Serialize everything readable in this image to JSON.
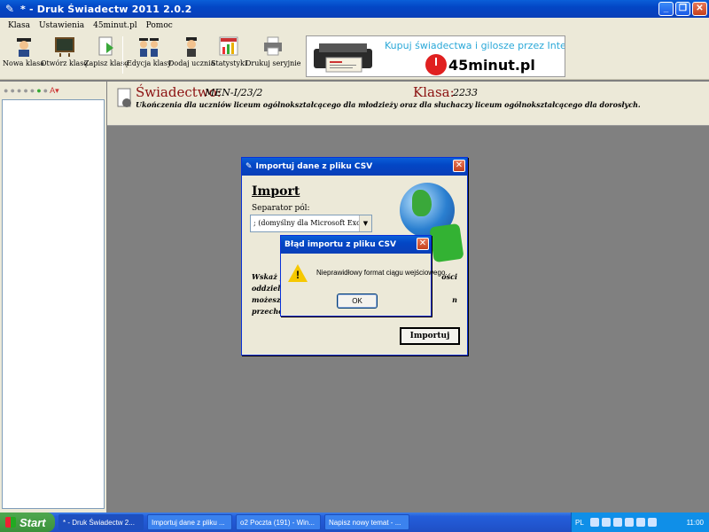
{
  "window": {
    "title": "* - Druk Świadectw 2011 2.0.2",
    "buttons": {
      "minimize": "_",
      "maximize": "❐",
      "close": "✕"
    }
  },
  "menu": [
    "Klasa",
    "Ustawienia",
    "45minut.pl",
    "Pomoc"
  ],
  "toolbar": {
    "items": [
      {
        "label": "Nowa klasa",
        "icon": "graduate-icon"
      },
      {
        "label": "Otwórz klasę",
        "icon": "chalkboard-icon"
      },
      {
        "label": "Zapisz klasę",
        "icon": "save-arrow-icon"
      },
      {
        "label": "Edycja klasy",
        "icon": "graduates-icon"
      },
      {
        "label": "Dodaj ucznia",
        "icon": "student-icon"
      },
      {
        "label": "Statystyki",
        "icon": "chart-icon"
      },
      {
        "label": "Drukuj seryjnie",
        "icon": "printer-icon"
      }
    ]
  },
  "ad": {
    "text": "Kupuj świadectwa i gilosze przez Internet",
    "brand": "45minut.pl"
  },
  "header": {
    "label": "Świadectwo:",
    "value": "MEN-I/23/2",
    "klasa_label": "Klasa:",
    "klasa_value": "2233",
    "description": "Ukończenia dla uczniów liceum ogólnokształcącego dla młodzieży oraz dla słuchaczy liceum ogólnokształcącego dla dorosłych."
  },
  "import_dialog": {
    "title": "Importuj dane z pliku CSV",
    "heading": "Import",
    "separator_label": "Separator pól:",
    "separator_value": "; (domyślny dla Microsoft Excel)",
    "text_lines": [
      "Wskaż pl",
      "oddzielon",
      "możesz u",
      "przechow"
    ],
    "text_lines_right": [
      "ości",
      "",
      "n",
      ""
    ],
    "button": "Importuj"
  },
  "error_dialog": {
    "title": "Błąd importu z pliku CSV",
    "message": "Nieprawidłowy format ciągu wejściowego.",
    "ok": "OK"
  },
  "taskbar": {
    "start": "Start",
    "tasks": [
      "* - Druk Świadectw 2...",
      "Importuj dane z pliku ...",
      "o2 Poczta (191) - Win...",
      "Napisz nowy temat - ..."
    ],
    "lang": "PL",
    "time": "11:00"
  }
}
